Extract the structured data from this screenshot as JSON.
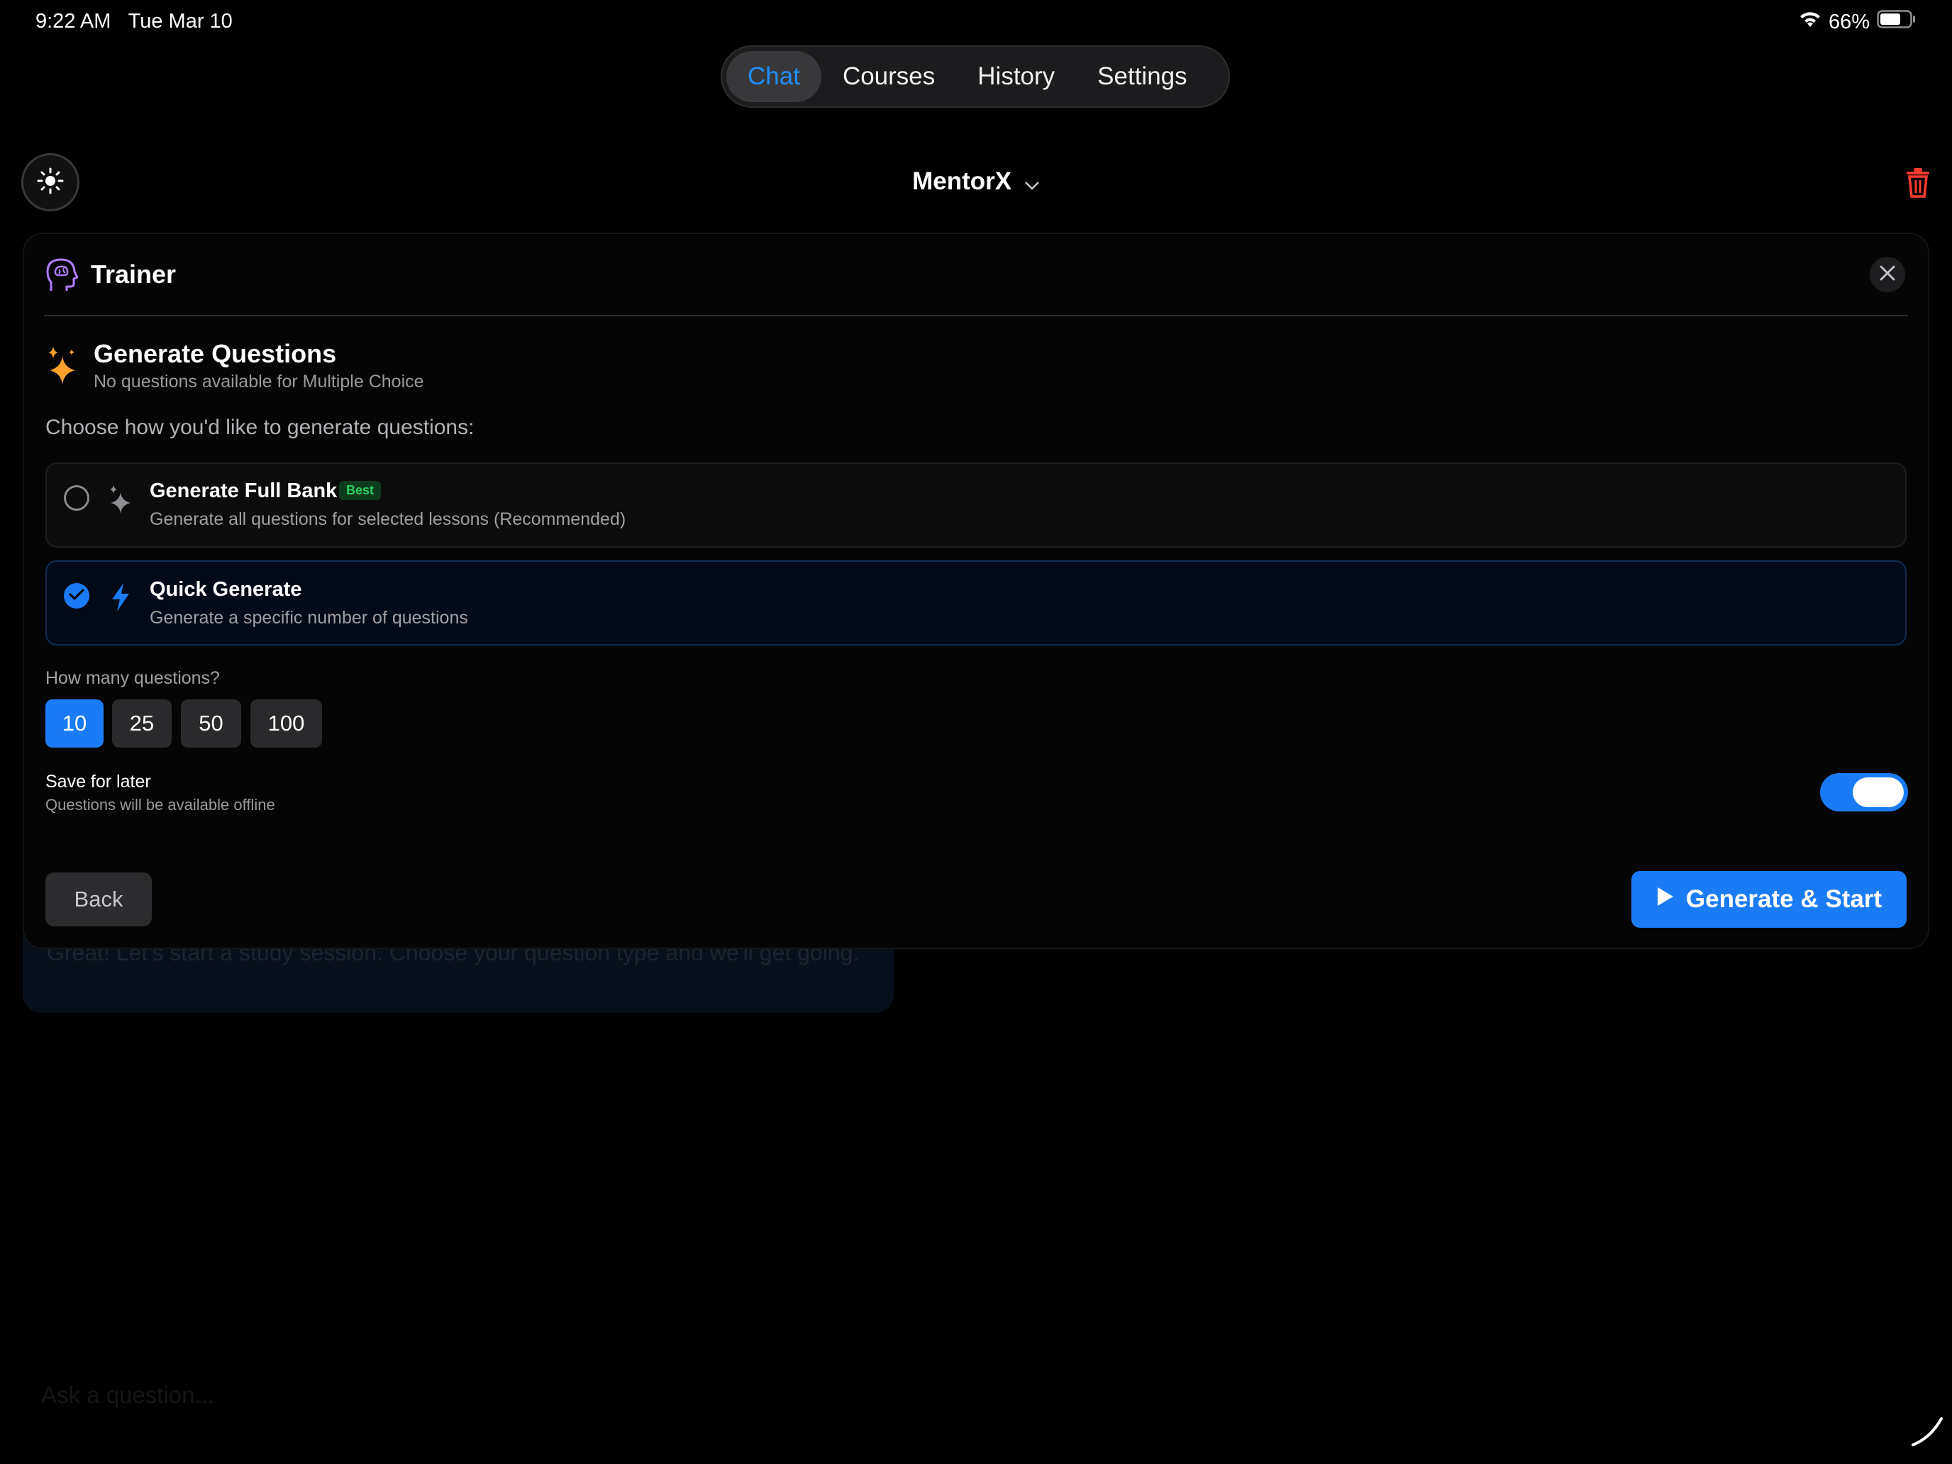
{
  "status_bar": {
    "time": "9:22 AM",
    "date": "Tue Mar 10",
    "battery": "66%"
  },
  "nav": {
    "tabs": [
      {
        "label": "Chat",
        "active": true
      },
      {
        "label": "Courses",
        "active": false
      },
      {
        "label": "History",
        "active": false
      },
      {
        "label": "Settings",
        "active": false
      }
    ]
  },
  "header": {
    "model_name": "MentorX"
  },
  "background": {
    "bubble_text": "Great! Let's start a study session. Choose your question type and we'll get going.",
    "input_placeholder": "Ask a question..."
  },
  "trainer": {
    "title": "Trainer",
    "section_title": "Generate Questions",
    "section_subtitle": "No questions available for Multiple Choice",
    "choose_label": "Choose how you'd like to generate questions:",
    "options": [
      {
        "title": "Generate Full Bank",
        "badge": "Best",
        "description": "Generate all questions for selected lessons (Recommended)",
        "selected": false
      },
      {
        "title": "Quick Generate",
        "description": "Generate a specific number of questions",
        "selected": true
      }
    ],
    "count_label": "How many questions?",
    "counts": [
      "10",
      "25",
      "50",
      "100"
    ],
    "selected_count": "10",
    "save_title": "Save for later",
    "save_subtitle": "Questions will be available offline",
    "save_enabled": true,
    "back_label": "Back",
    "start_label": "Generate & Start"
  },
  "colors": {
    "accent": "#1a7cf5",
    "danger": "#ff3b30",
    "sparkle": "#ff9f2e",
    "brain": "#b07cff"
  }
}
